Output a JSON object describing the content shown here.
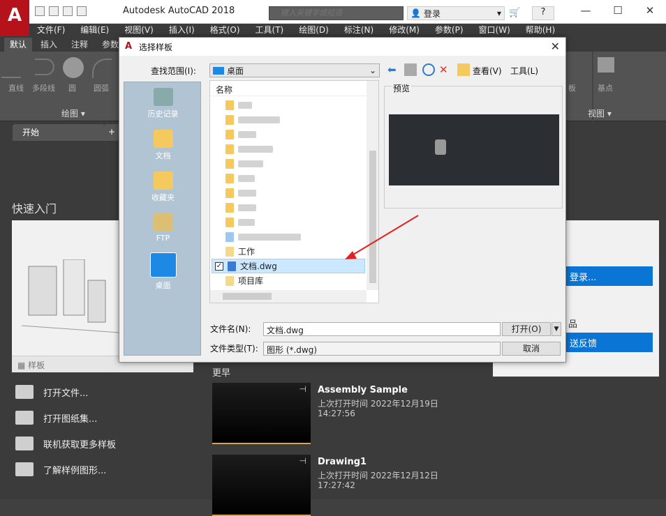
{
  "app": {
    "title": "Autodesk AutoCAD 2018",
    "logo_letter": "A"
  },
  "search": {
    "placeholder": "键入关键字或短语"
  },
  "account": {
    "login_label": "登录"
  },
  "window_controls": {
    "minimize": "—",
    "maximize": "☐",
    "close": "✕"
  },
  "menubar": [
    "文件(F)",
    "编辑(E)",
    "视图(V)",
    "插入(I)",
    "格式(O)",
    "工具(T)",
    "绘图(D)",
    "标注(N)",
    "修改(M)",
    "参数(P)",
    "窗口(W)",
    "帮助(H)"
  ],
  "ribbon": {
    "tabs": [
      "默认",
      "插入",
      "注释",
      "参数"
    ],
    "draw_tools": [
      "直线",
      "多段线",
      "圆",
      "圆弧"
    ],
    "draw_panel_label": "绘图 ▾",
    "view_panel_label": "视图 ▾",
    "basepoint_label": "基点",
    "panel_label": "板"
  },
  "doc_tabs": {
    "start": "开始",
    "add": "+"
  },
  "start": {
    "quick_start_title": "快速入门",
    "template_label": "样板",
    "links": [
      "打开文件...",
      "打开图纸集...",
      "联机获取更多样板",
      "了解样例图形..."
    ],
    "recent_header": "更早",
    "recent": [
      {
        "title": "Assembly Sample",
        "opened": "上次打开时间 2022年12月19日",
        "time": "14:27:56"
      },
      {
        "title": "Drawing1",
        "opened": "上次打开时间 2022年12月12日",
        "time": "17:27:42"
      }
    ],
    "right_panel": {
      "login_button": "登录...",
      "feedback_button": "送反馈",
      "product_label": "品"
    }
  },
  "dialog": {
    "title": "选择样板",
    "look_in_label": "查找范围(I):",
    "look_in_value": "桌面",
    "views_label": "查看(V)",
    "tools_label": "工具(L)",
    "places": [
      "历史记录",
      "文档",
      "收藏夹",
      "FTP",
      "桌面"
    ],
    "column_name": "名称",
    "files": [
      {
        "name": "工作",
        "type": "shortcut"
      },
      {
        "name": "文档.dwg",
        "type": "dwg",
        "selected": true
      },
      {
        "name": "项目库",
        "type": "shortcut"
      }
    ],
    "preview_label": "预览",
    "filename_label": "文件名(N):",
    "filename_value": "文档.dwg",
    "filetype_label": "文件类型(T):",
    "filetype_value": "图形 (*.dwg)",
    "open_button": "打开(O)",
    "cancel_button": "取消"
  },
  "colors": {
    "autocad_red": "#b5121b",
    "accent_blue": "#0b75d6",
    "annotation_arrow": "#e8201c"
  }
}
